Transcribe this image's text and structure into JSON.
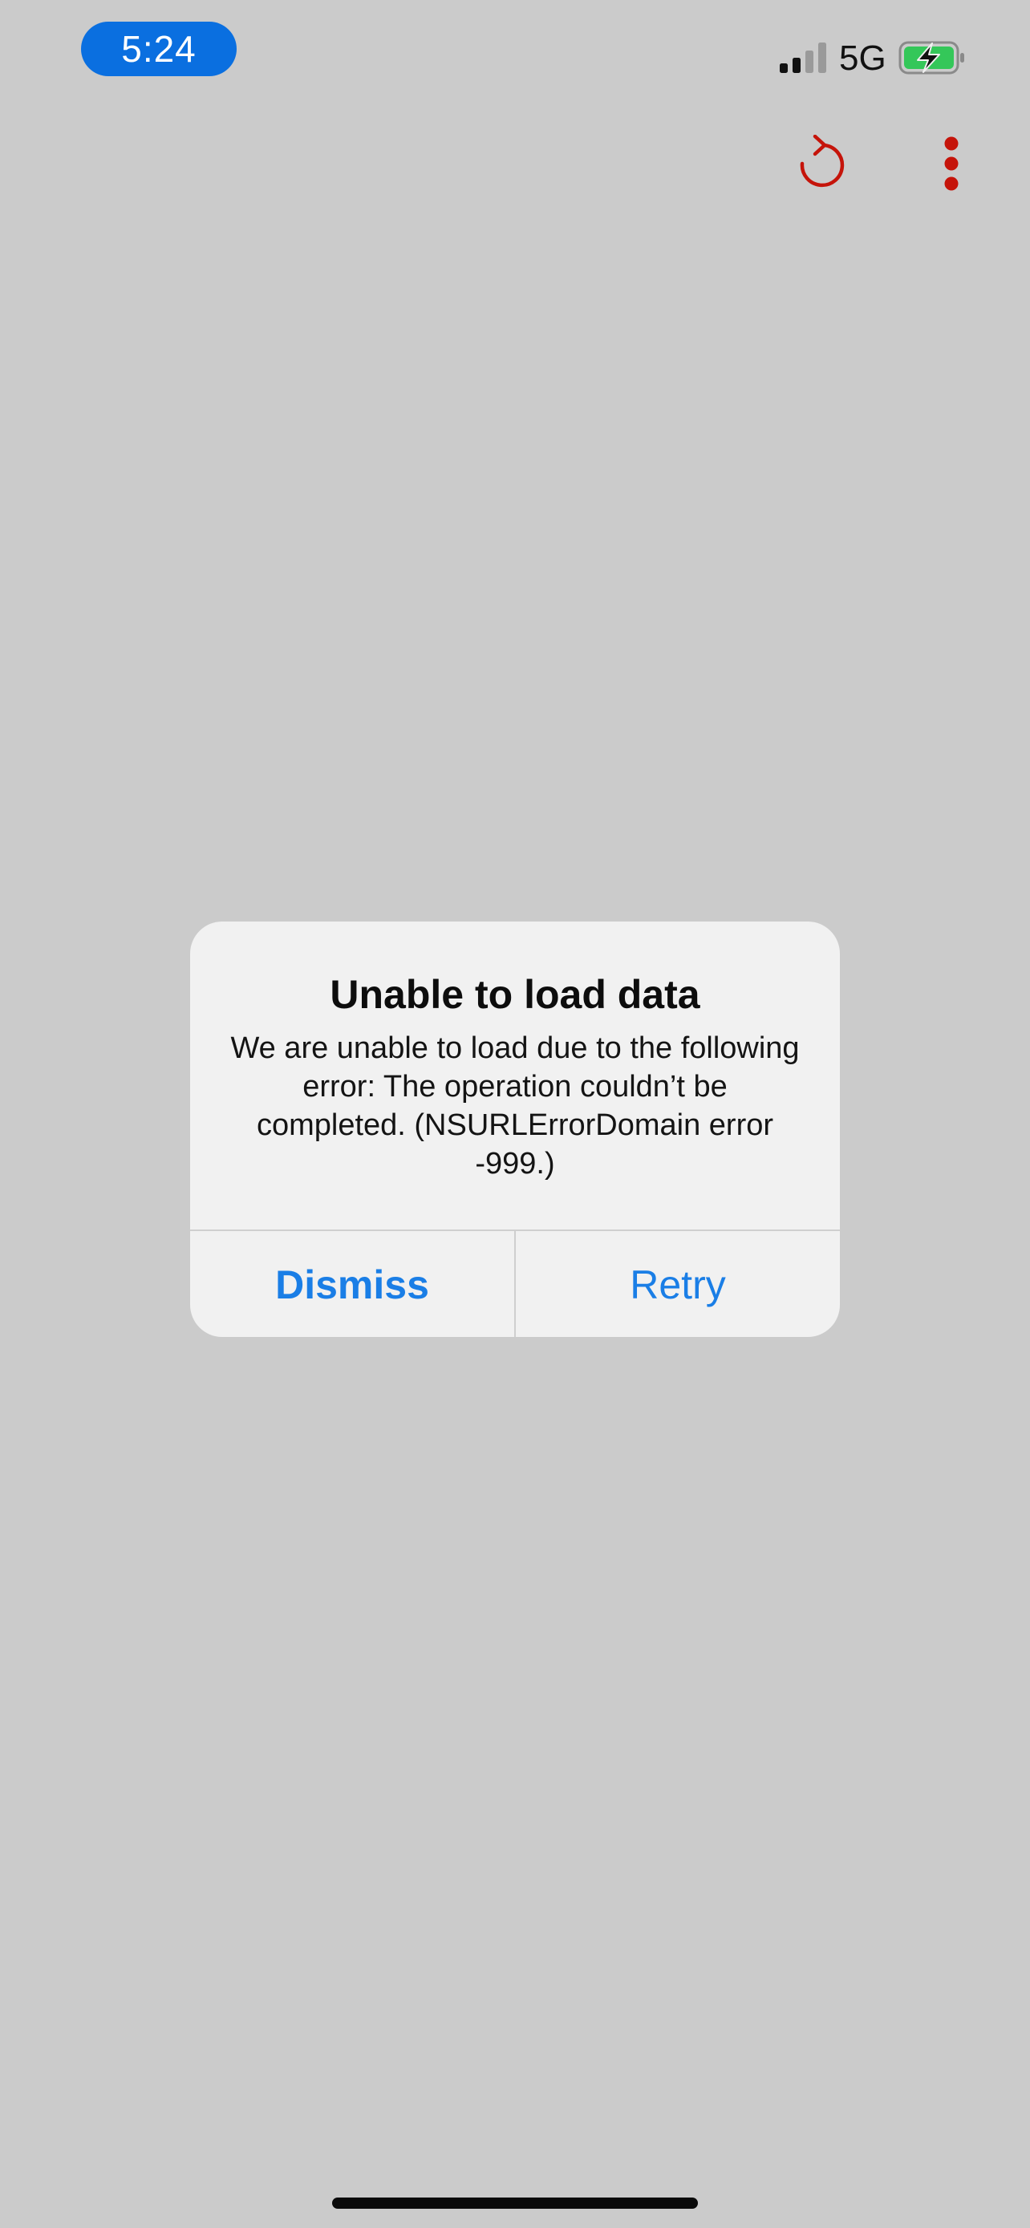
{
  "status_bar": {
    "time": "5:24",
    "network": "5G",
    "signal_bars_active": 2,
    "signal_bars_total": 4,
    "battery_charging": true,
    "time_pill_color": "#0a6fe0",
    "battery_color": "#34c759"
  },
  "toolbar": {
    "refresh_icon": "refresh-icon",
    "more_icon": "more-vertical-icon",
    "accent_color": "#c5140a"
  },
  "alert": {
    "title": "Unable to load data",
    "message": "We are unable to load due to the following error: The operation couldn’t be completed. (NSURLErrorDomain error -999.)",
    "dismiss_label": "Dismiss",
    "retry_label": "Retry",
    "button_color": "#1a7ee6"
  }
}
